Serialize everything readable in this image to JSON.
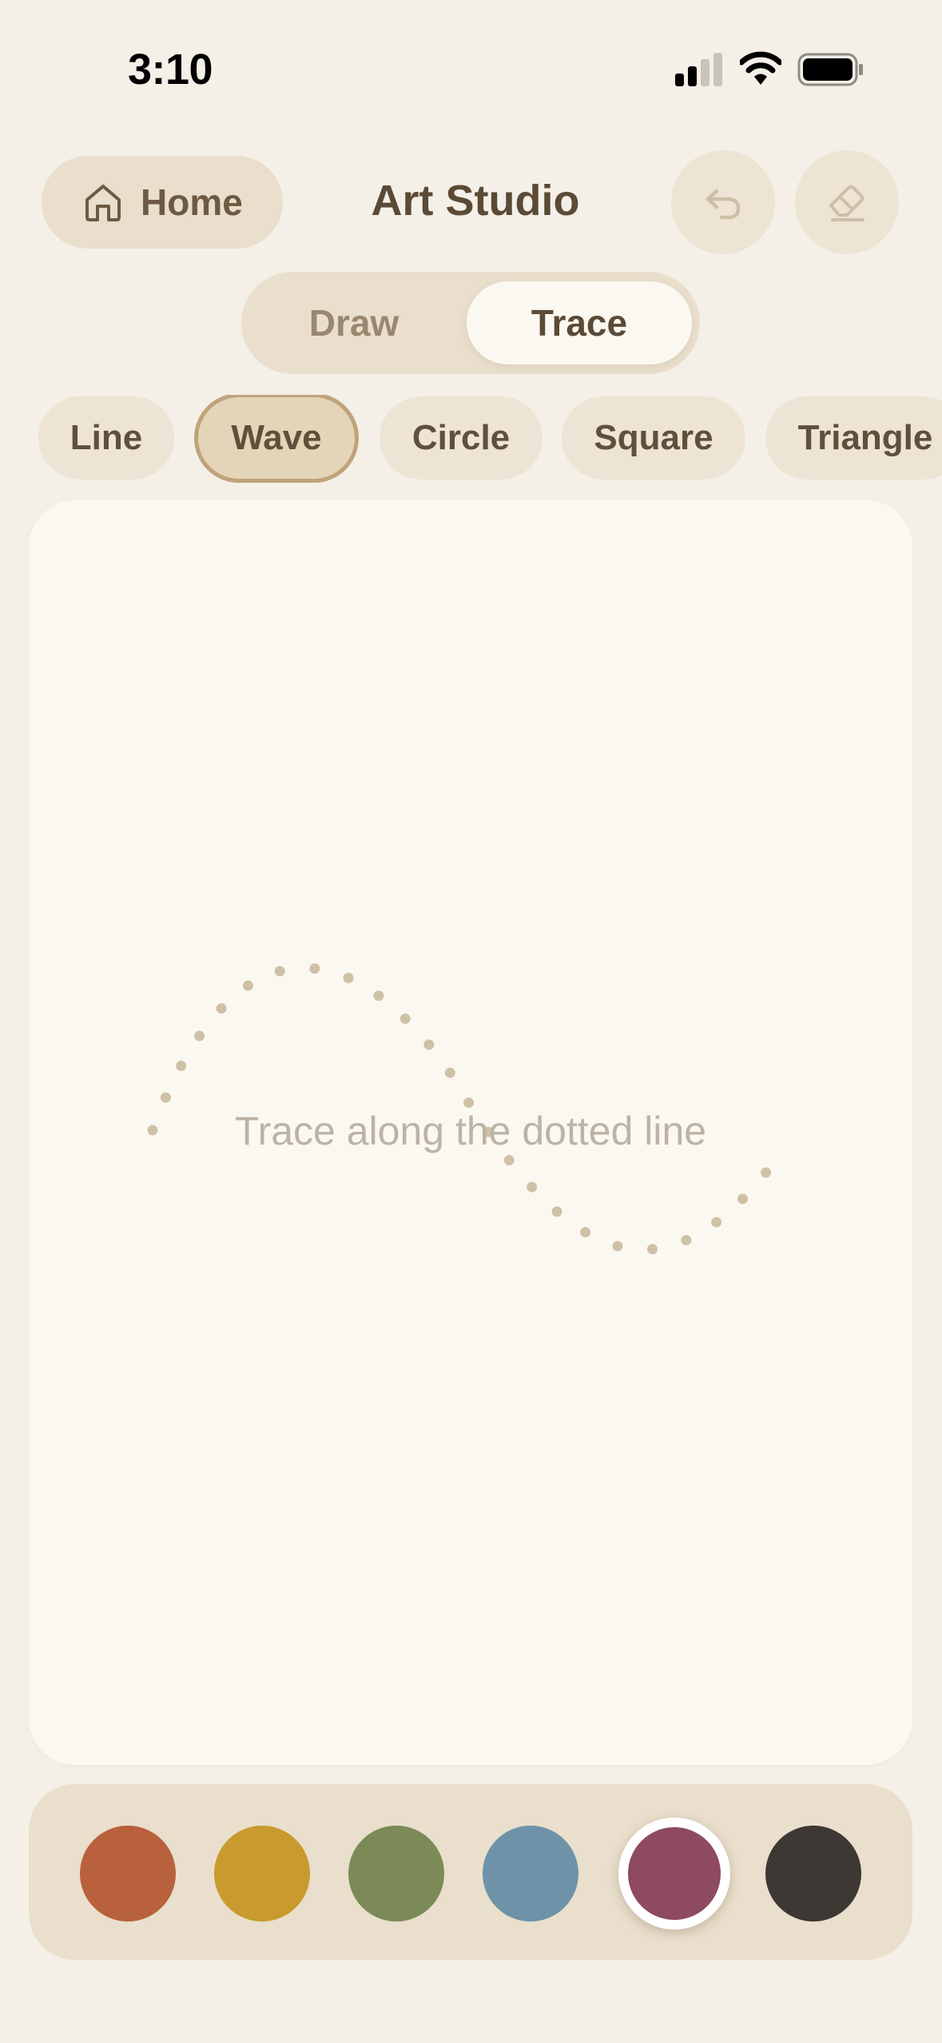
{
  "status_bar": {
    "time": "3:10"
  },
  "header": {
    "home_label": "Home",
    "title": "Art Studio",
    "undo_icon": "undo-icon",
    "eraser_icon": "eraser-icon"
  },
  "mode_toggle": {
    "options": [
      "Draw",
      "Trace"
    ],
    "selected": "Trace"
  },
  "shapes": {
    "items": [
      "Line",
      "Wave",
      "Circle",
      "Square",
      "Triangle"
    ],
    "selected": "Wave"
  },
  "canvas": {
    "hint": "Trace along the dotted line",
    "guide_color": "#CFC1A6"
  },
  "palette": {
    "colors": [
      "#B8613C",
      "#C99A2E",
      "#7B8A56",
      "#6E93A8",
      "#8E4A5E",
      "#3D3833"
    ],
    "selected_index": 4
  },
  "theme": {
    "background": "#F4F0E7",
    "accent": "#BFA37A",
    "text": "#5A4A36"
  }
}
